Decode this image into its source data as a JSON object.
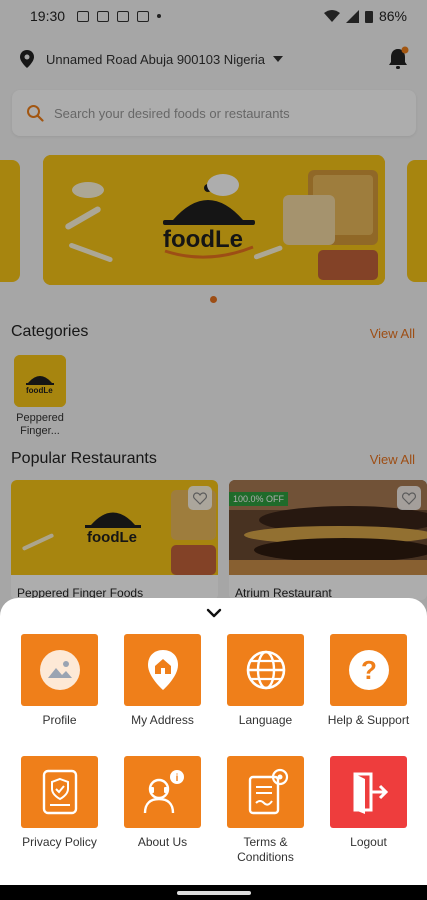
{
  "status_bar": {
    "time": "19:30",
    "battery": "86%"
  },
  "header": {
    "location": "Unnamed Road Abuja 900103 Nigeria"
  },
  "search": {
    "placeholder": "Search your desired foods or restaurants"
  },
  "banner": {
    "brand": "foodLe"
  },
  "categories": {
    "title": "Categories",
    "view_all": "View All",
    "items": [
      {
        "label": "Peppered Finger..."
      }
    ]
  },
  "popular": {
    "title": "Popular Restaurants",
    "view_all": "View All",
    "items": [
      {
        "name": "Peppered Finger Foods"
      },
      {
        "name": "Atrium Restaurant",
        "discount": "100.0% OFF"
      }
    ]
  },
  "menu": {
    "items": [
      {
        "label": "Profile",
        "icon": "image-icon"
      },
      {
        "label": "My Address",
        "icon": "home-pin-icon"
      },
      {
        "label": "Language",
        "icon": "globe-icon"
      },
      {
        "label": "Help & Support",
        "icon": "question-icon"
      },
      {
        "label": "Privacy Policy",
        "icon": "shield-document-icon"
      },
      {
        "label": "About Us",
        "icon": "person-info-icon"
      },
      {
        "label": "Terms & Conditions",
        "icon": "terms-document-icon"
      },
      {
        "label": "Logout",
        "icon": "logout-door-icon"
      }
    ]
  },
  "colors": {
    "accent": "#ef7f1a",
    "logout": "#ee3d3d",
    "banner": "#f7c417"
  }
}
